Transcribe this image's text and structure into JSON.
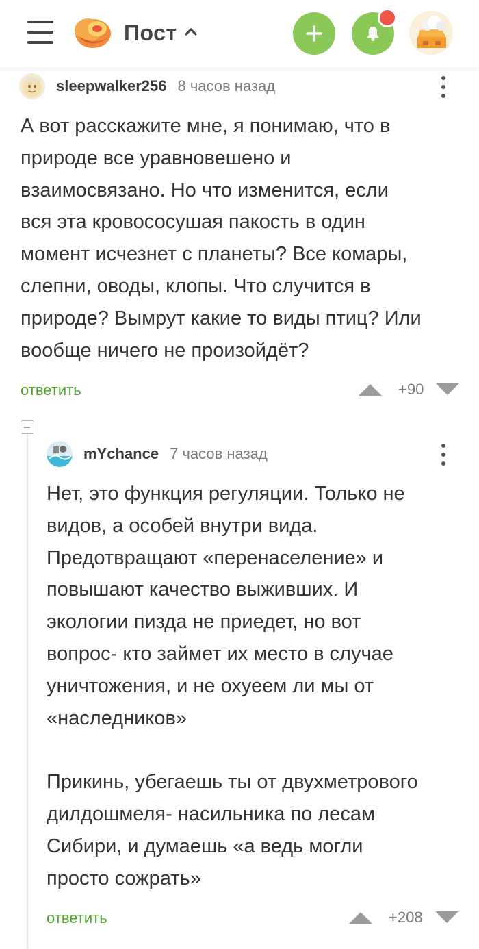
{
  "header": {
    "title": "Пост",
    "menu_icon": "hamburger-menu-icon",
    "logo_icon": "pikabu-logo-icon",
    "add_icon": "plus-icon",
    "notifications_icon": "bell-icon",
    "accent_color": "#8ac858",
    "badge_color": "#f0574b"
  },
  "comments": [
    {
      "author": "sleepwalker256",
      "time": "8 часов назад",
      "text": "А вот расскажите мне, я понимаю, что в\nприроде все уравновешено и\nвзаимосвязано. Но что изменится, если\nвся эта кровососушая пакость в один\nмомент исчезнет с планеты? Все комары,\nслепни, оводы, клопы. Что случится в\nприроде? Вымрут какие то виды птиц? Или\nвообще ничего не произойдёт?",
      "reply_label": "ответить",
      "score": "+90"
    },
    {
      "author": "mYchance",
      "time": "7 часов назад",
      "text": "Нет, это функция регуляции. Только не\nвидов, а особей внутри вида.\nПредотвращают «перенаселение» и\nповышают качество выживших. И\nэкологии пизда не приедет, но вот\nвопрос- кто займет их место в случае\nуничтожения, и не охуеем ли мы от\n«наследников»\n\nПрикинь, убегаешь ты от двухметрового\nдилдошмеля- насильника по лесам\nСибири, и думаешь «а ведь могли\nпросто сожрать»",
      "reply_label": "ответить",
      "score": "+208"
    }
  ]
}
